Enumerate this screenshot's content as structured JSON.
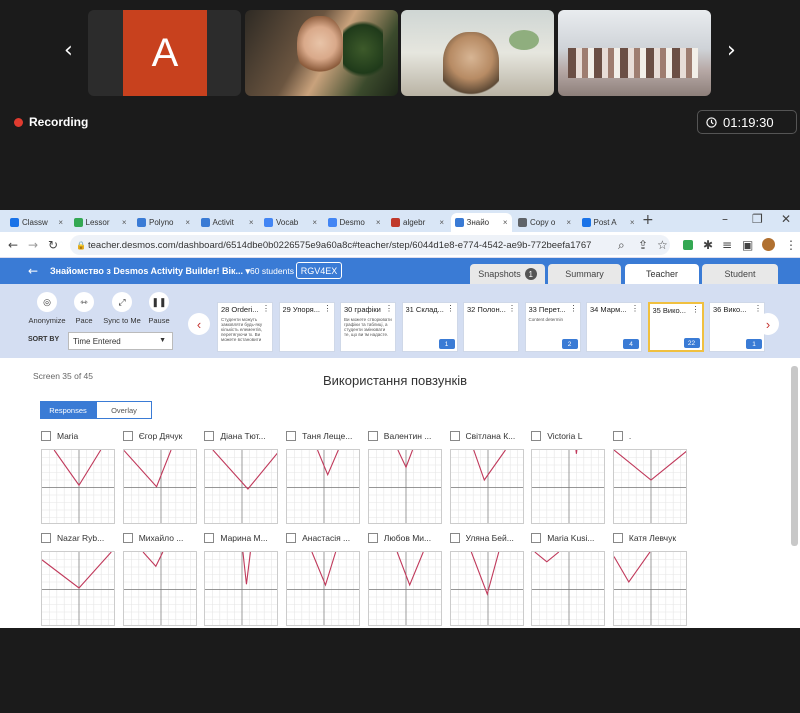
{
  "call": {
    "avatar_letter": "A",
    "recording_label": "Recording",
    "timer": "01:19:30"
  },
  "browser": {
    "tabs": [
      {
        "label": "Classw",
        "color": "#1a73e8"
      },
      {
        "label": "Lessor",
        "color": "#34a853"
      },
      {
        "label": "Polyno",
        "color": "#3a7bd5"
      },
      {
        "label": "Activit",
        "color": "#3a7bd5"
      },
      {
        "label": "Vocab",
        "color": "#4285f4"
      },
      {
        "label": "Desmo",
        "color": "#4285f4"
      },
      {
        "label": "algebr",
        "color": "#c0392b"
      },
      {
        "label": "Знайо",
        "color": "#3a7bd5"
      },
      {
        "label": "Copy o",
        "color": "#5f6368"
      },
      {
        "label": "Post A",
        "color": "#1a73e8"
      }
    ],
    "new_tab": "+",
    "url": "teacher.desmos.com/dashboard/6514dbe0b0226575e9a60a8c#teacher/step/6044d1e8-e774-4542-ae9b-772beefa1767"
  },
  "header": {
    "title": "Знайомство з Desmos Activity Builder! Вік...",
    "students": "60 students",
    "code": "RGV4EX",
    "tabs": {
      "snapshots": "Snapshots",
      "snapshots_count": "1",
      "summary": "Summary",
      "teacher": "Teacher",
      "student": "Student"
    }
  },
  "panel": {
    "controls": {
      "anonymize": "Anonymize",
      "pace": "Pace",
      "sync": "Sync to Me",
      "pause": "Pause"
    },
    "sort_by": "SORT BY",
    "sort_value": "Time Entered",
    "cards": [
      {
        "title": "28 Orderi...",
        "text": "Студенти можуть замовляти будь-яку кількість елементів, перетягуючи їх. Ви можете встановити",
        "count": ""
      },
      {
        "title": "29 Упоря...",
        "text": "",
        "count": ""
      },
      {
        "title": "30 графіки",
        "text": "Ви можете створювати графіки та таблиці, а студенти змінювати те, що ви їм надасте.",
        "count": ""
      },
      {
        "title": "31 Склад...",
        "text": "",
        "count": "1"
      },
      {
        "title": "32 Полон...",
        "text": "",
        "count": ""
      },
      {
        "title": "33 Перет...",
        "text": "Content determin",
        "count": "2"
      },
      {
        "title": "34 Марм...",
        "text": "",
        "count": "4"
      },
      {
        "title": "35 Вико...",
        "text": "",
        "count": "22"
      },
      {
        "title": "36 Вико...",
        "text": "",
        "count": "1"
      }
    ]
  },
  "main": {
    "screen_count": "Screen 35 of 45",
    "title": "Використання повзунків",
    "toggle": {
      "responses": "Responses",
      "overlay": "Overlay"
    },
    "students_row1": [
      {
        "name": "Maria",
        "vx": 5.0,
        "vy": 4.7,
        "sl": 1.4,
        "sr": 1.6
      },
      {
        "name": "Єгор Дячук",
        "vx": 4.4,
        "vy": 4.9,
        "sl": 1.1,
        "sr": 2.5
      },
      {
        "name": "Діана Тют...",
        "vx": 5.8,
        "vy": 5.2,
        "sl": 1.1,
        "sr": 1.2
      },
      {
        "name": "Таня Леще...",
        "vx": 5.5,
        "vy": 3.3,
        "sl": 2.4,
        "sr": 2.3
      },
      {
        "name": "Валентин ...",
        "vx": 5.0,
        "vy": 2.3,
        "sl": 2.1,
        "sr": 2.6
      },
      {
        "name": "Світлана К...",
        "vx": 4.5,
        "vy": 4.0,
        "sl": 2.8,
        "sr": 1.4
      },
      {
        "name": "Victoria L",
        "vx": 6.0,
        "vy": 0.5,
        "sl": 8.0,
        "sr": 8.0
      },
      {
        "name": ".",
        "vx": 5.0,
        "vy": 4.0,
        "sl": 0.8,
        "sr": 0.8
      }
    ],
    "students_row2": [
      {
        "name": "Nazar Ryb...",
        "vx": 5.0,
        "vy": 4.8,
        "sl": 0.75,
        "sr": 1.1
      },
      {
        "name": "Михайло ...",
        "vx": 4.3,
        "vy": 1.9,
        "sl": 1.1,
        "sr": 2.0
      },
      {
        "name": "Марина М...",
        "vx": 5.6,
        "vy": 4.3,
        "sl": 9.0,
        "sr": 8.0
      },
      {
        "name": "Анастасія ...",
        "vx": 5.2,
        "vy": 4.4,
        "sl": 2.4,
        "sr": 3.2
      },
      {
        "name": "Любов Ми...",
        "vx": 5.5,
        "vy": 4.4,
        "sl": 2.6,
        "sr": 2.4
      },
      {
        "name": "Уляна Бей...",
        "vx": 4.9,
        "vy": 5.6,
        "sl": 2.6,
        "sr": 3.6
      },
      {
        "name": "Maria Kusi...",
        "vx": 2.0,
        "vy": 1.3,
        "sl": 0.8,
        "sr": 0.8
      },
      {
        "name": "Катя Левчук",
        "vx": 2.0,
        "vy": 4.0,
        "sl": 1.7,
        "sr": 1.4
      }
    ],
    "line_color": "#c0395b"
  }
}
